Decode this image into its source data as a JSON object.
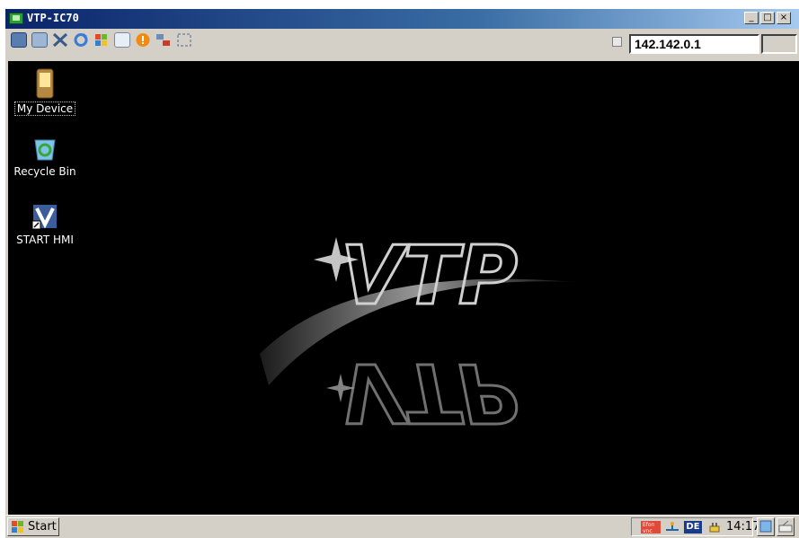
{
  "window": {
    "title": "VTP-IC70",
    "minimize_icon": "minimize-icon",
    "maximize_icon": "maximize-icon",
    "close_icon": "close-icon"
  },
  "toolbar": {
    "icons": [
      "monitor-icon",
      "file-transfer-icon",
      "tools-icon",
      "refresh-icon",
      "windows-logo-icon",
      "keyboard-icon",
      "alert-icon",
      "network-icon",
      "fullscreen-icon"
    ],
    "ip_address": "142.142.0.1"
  },
  "desktop": {
    "icons": [
      {
        "label": "My Device",
        "icon": "pda-device-icon"
      },
      {
        "label": "Recycle Bin",
        "icon": "recycle-bin-icon"
      },
      {
        "label": "START HMI",
        "icon": "vtp-shortcut-icon"
      }
    ],
    "logo_text": "VTP",
    "background_color": "#000000"
  },
  "taskbar": {
    "start_label": "Start",
    "tray": {
      "icons": [
        "vnc-icon",
        "usb-icon",
        "language-icon",
        "power-icon"
      ],
      "language": "DE",
      "vnc_label": "Efon vnc",
      "clock": "14:17"
    },
    "buttons": [
      "desktop-icon",
      "keyboard-icon"
    ]
  }
}
